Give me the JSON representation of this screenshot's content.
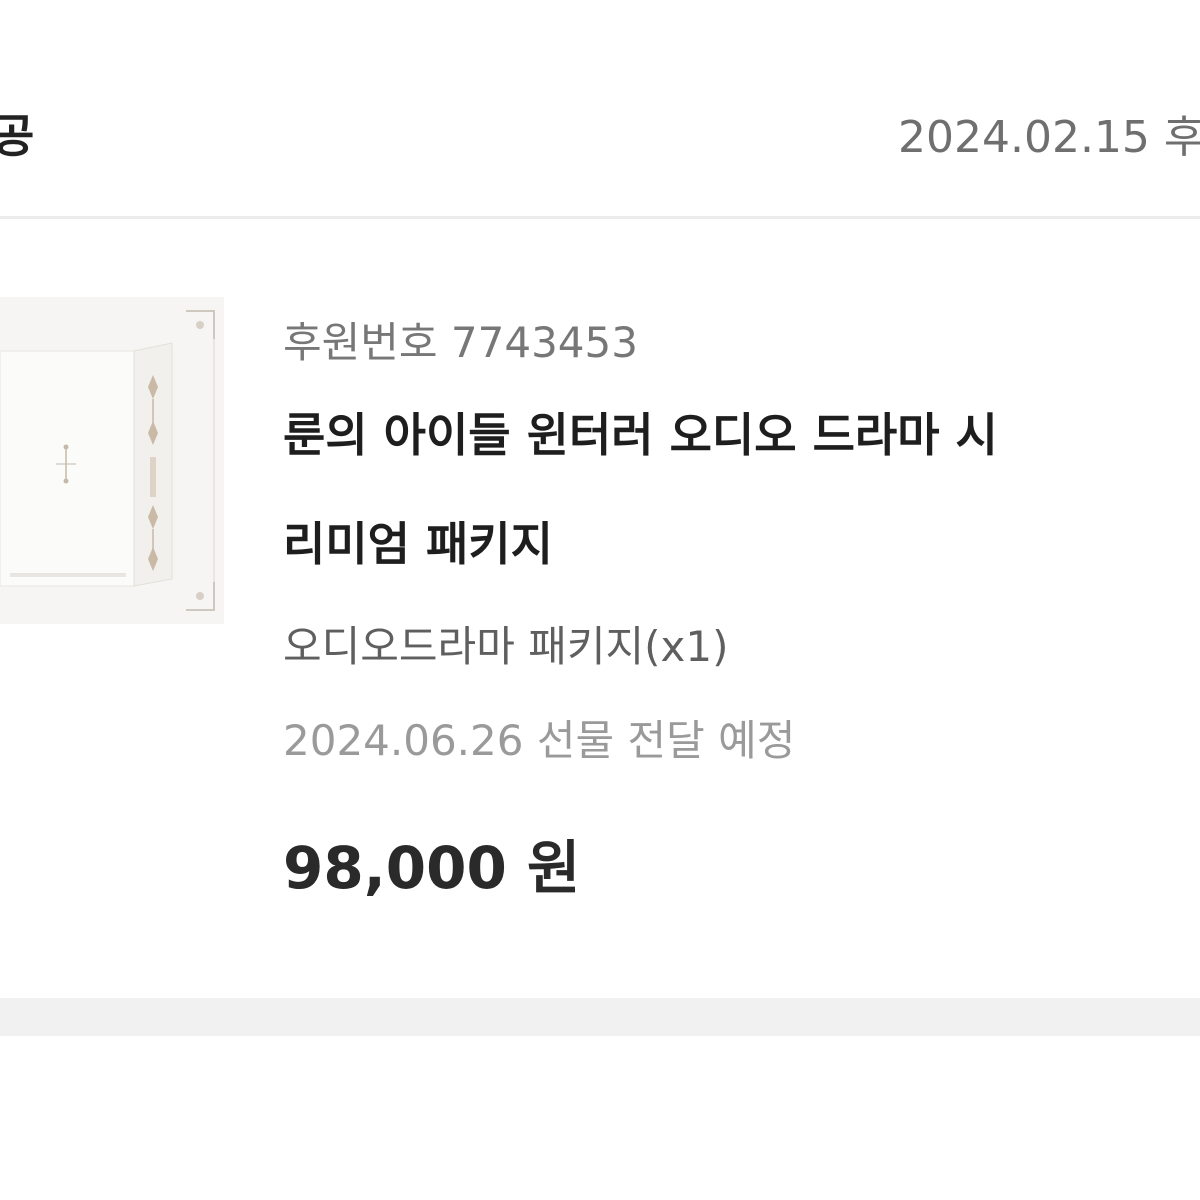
{
  "header": {
    "status_label": "공",
    "date": "2024.02.15 후"
  },
  "item": {
    "thumbnail_icon": "product-box-icon",
    "order_number": "후원번호 7743453",
    "title_lines": [
      "룬의 아이들 윈터러 오디오 드라마 시",
      "리미엄 패키지"
    ],
    "option": "오디오드라마 패키지(x1)",
    "delivery": "2024.06.26 선물 전달 예정",
    "price": "98,000 원"
  },
  "colors": {
    "divider": "#ececec",
    "section_gap": "#f1f1f1",
    "title_text": "#1e1e1e",
    "muted_text": "#777777"
  }
}
